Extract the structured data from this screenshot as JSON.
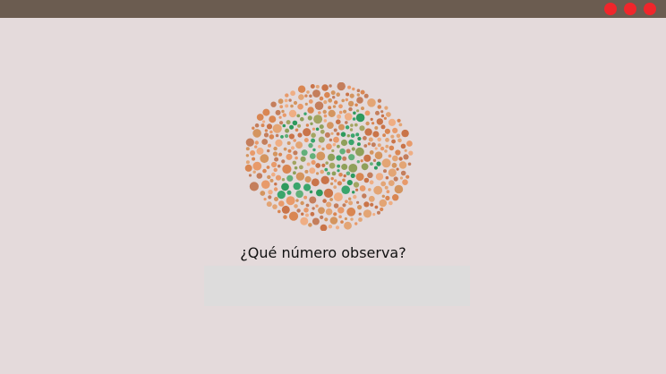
{
  "window": {
    "controls": [
      "window-close",
      "window-minimize",
      "window-maximize"
    ],
    "control_color": "#f0262b",
    "titlebar_color": "#6b5c50"
  },
  "plate": {
    "hidden_number": "24",
    "colors": {
      "background_dots": [
        "#e89a6a",
        "#d98652",
        "#c97449",
        "#efae84",
        "#d4955f",
        "#c47e5c",
        "#e3a575"
      ],
      "figure_dots": [
        "#3aa56c",
        "#2e9a5d",
        "#62b07a",
        "#a3a562",
        "#8fa05a"
      ]
    }
  },
  "prompt": {
    "question": "¿Qué número observa?"
  },
  "answer": {
    "value": "",
    "placeholder": ""
  }
}
